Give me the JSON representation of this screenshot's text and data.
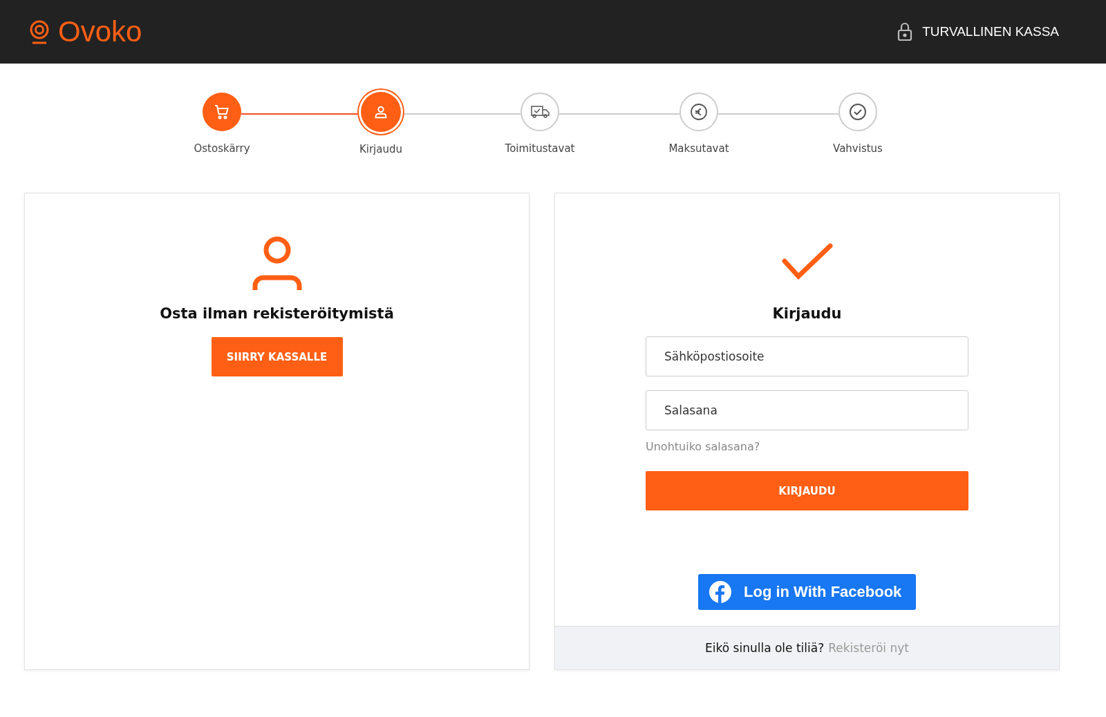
{
  "header": {
    "logo": "Ovoko",
    "secure_label": "TURVALLINEN KASSA"
  },
  "steps": [
    {
      "label": "Ostoskärry",
      "completed": true,
      "selected": false
    },
    {
      "label": "Kirjaudu",
      "completed": false,
      "selected": true
    },
    {
      "label": "Toimitustavat",
      "completed": false,
      "selected": false
    },
    {
      "label": "Maksutavat",
      "completed": false,
      "selected": false
    },
    {
      "label": "Vahvistus",
      "completed": false,
      "selected": false
    }
  ],
  "guest": {
    "title": "Osta ilman rekisteröitymistä",
    "button": "SIIRRY KASSALLE"
  },
  "login": {
    "title": "Kirjaudu",
    "email": {
      "placeholder": "Sähköpostiosoite"
    },
    "password": {
      "placeholder": "Salasana"
    },
    "forgot": "Unohtuiko salasana?",
    "button": "KIRJAUDU",
    "facebook": "Log in With Facebook",
    "footer_text": "Eikö sinulla ole tiliä?",
    "footer_link": "Rekisteröi nyt"
  }
}
